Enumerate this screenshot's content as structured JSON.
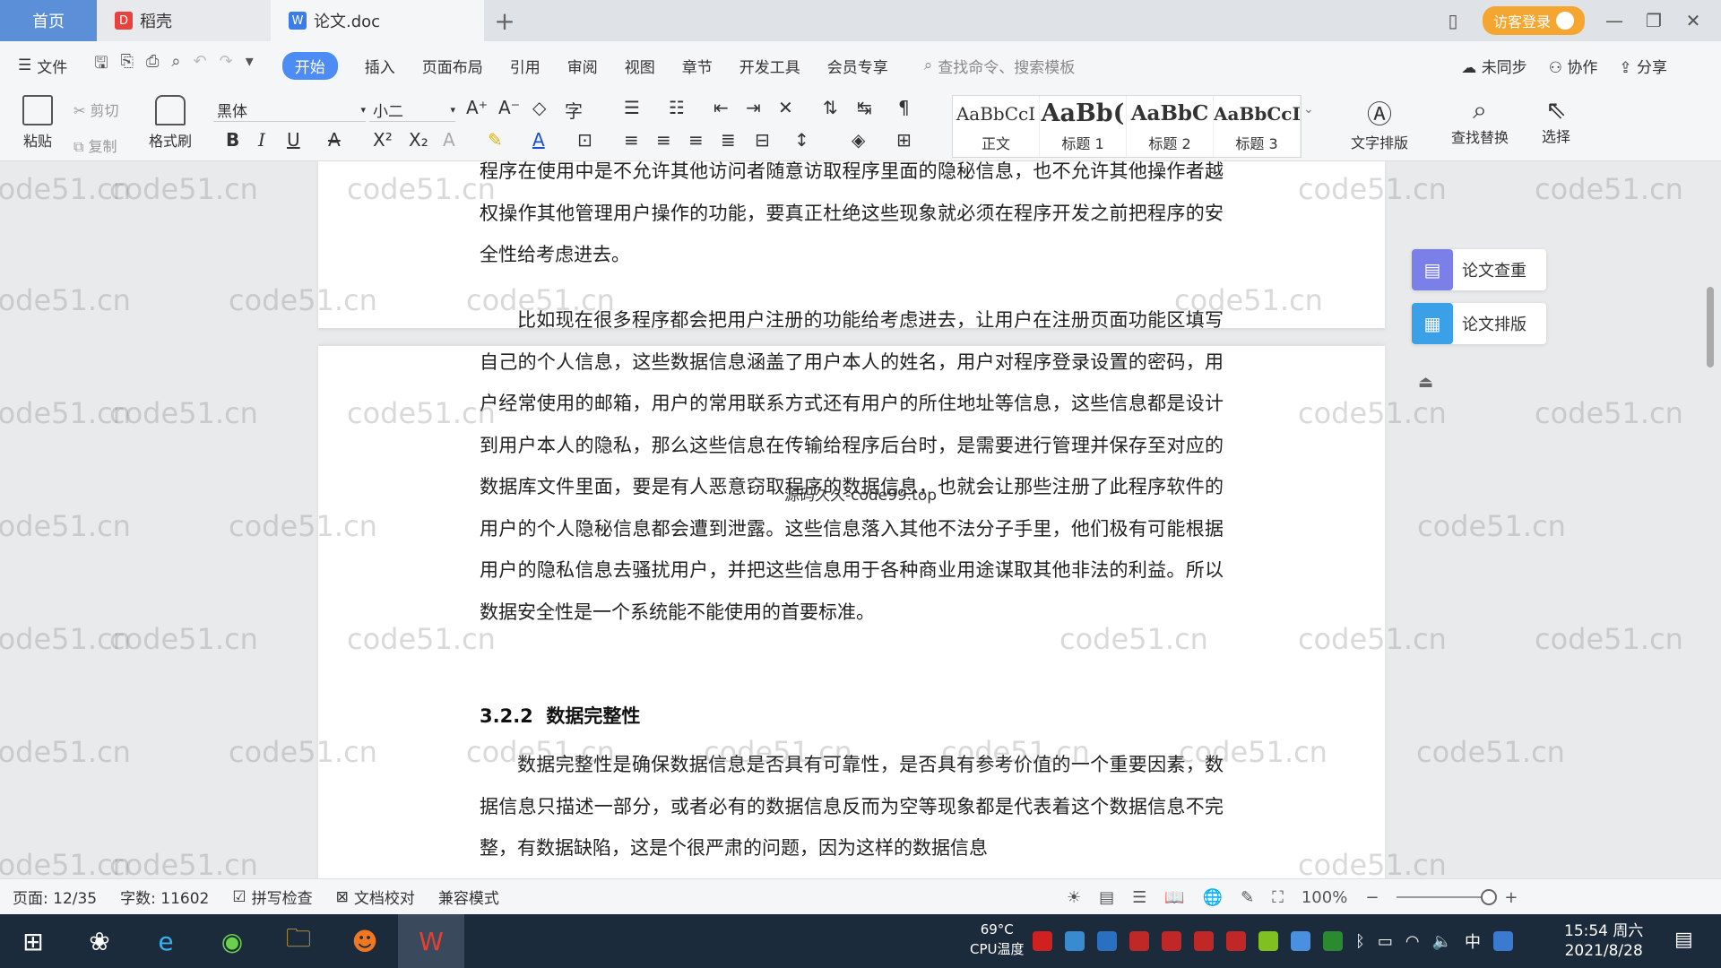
{
  "titlebar": {
    "tabs": [
      {
        "label": "首页"
      },
      {
        "label": "稻壳"
      },
      {
        "label": "论文.doc"
      }
    ],
    "login_label": "访客登录"
  },
  "menubar": {
    "file": "文件",
    "items": [
      "开始",
      "插入",
      "页面布局",
      "引用",
      "审阅",
      "视图",
      "章节",
      "开发工具",
      "会员专享"
    ],
    "search_placeholder": "查找命令、搜索模板",
    "right": [
      "未同步",
      "协作",
      "分享"
    ]
  },
  "ribbon": {
    "paste": "粘贴",
    "cut": "剪切",
    "copy": "复制",
    "format_painter": "格式刷",
    "font": "黑体",
    "size": "小二",
    "styles": [
      {
        "sample": "AaBbCcI",
        "label": "正文"
      },
      {
        "sample": "AaBb(",
        "label": "标题 1"
      },
      {
        "sample": "AaBbC",
        "label": "标题 2"
      },
      {
        "sample": "AaBbCcI",
        "label": "标题 3"
      }
    ],
    "text_layout": "文字排版",
    "find_replace": "查找替换",
    "select": "选择"
  },
  "document": {
    "para1": "程序在使用中是不允许其他访问者随意访取程序里面的隐秘信息，也不允许其他操作者越权操作其他管理用户操作的功能，要真正杜绝这些现象就必须在程序开发之前把程序的安全性给考虑进去。",
    "para2": "比如现在很多程序都会把用户注册的功能给考虑进去，让用户在注册页面功能区填写自己的个人信息，这些数据信息涵盖了用户本人的姓名，用户对程序登录设置的密码，用户经常使用的邮箱，用户的常用联系方式还有用户的所住地址等信息，这些信息都是设计到用户本人的隐私，那么这些信息在传输给程序后台时，是需要进行管理并保存至对应的数据库文件里面，要是有人恶意窃取程序的数据信息，也就会让那些注册了此程序软件的用户的个人隐秘信息都会遭到泄露。这些信息落入其他不法分子手里，他们极有可能根据用户的隐私信息去骚扰用户，并把这些信息用于各种商业用途谋取其他非法的利益。所以数据安全性是一个系统能不能使用的首要标准。",
    "heading_num": "3.2.2",
    "heading_text": "数据完整性",
    "para3": "数据完整性是确保数据信息是否具有可靠性，是否具有参考价值的一个重要因素，数据信息只描述一部分，或者必有的数据信息反而为空等现象都是代表着这个数据信息不完整，有数据缺陷，这是个很严肃的问题，因为这样的数据信息",
    "overlay_text": "源码久久-code99.top",
    "watermark_text": "code51.cn"
  },
  "side_panel": {
    "check": "论文查重",
    "layout": "论文排版"
  },
  "statusbar": {
    "page": "页面: 12/35",
    "words": "字数: 11602",
    "spell": "拼写检查",
    "proof": "文档校对",
    "compat": "兼容模式",
    "zoom": "100%",
    "zoom_fraction": 0.5
  },
  "taskbar": {
    "cpu_temp": "69°C",
    "cpu_label": "CPU温度",
    "ime": "中",
    "time": "15:54 周六",
    "date": "2021/8/28"
  },
  "colors": {
    "accent": "#4d8cf4",
    "home_tab": "#5b8fd8",
    "login": "#f4a630",
    "taskbar": "#1c2b3c"
  }
}
